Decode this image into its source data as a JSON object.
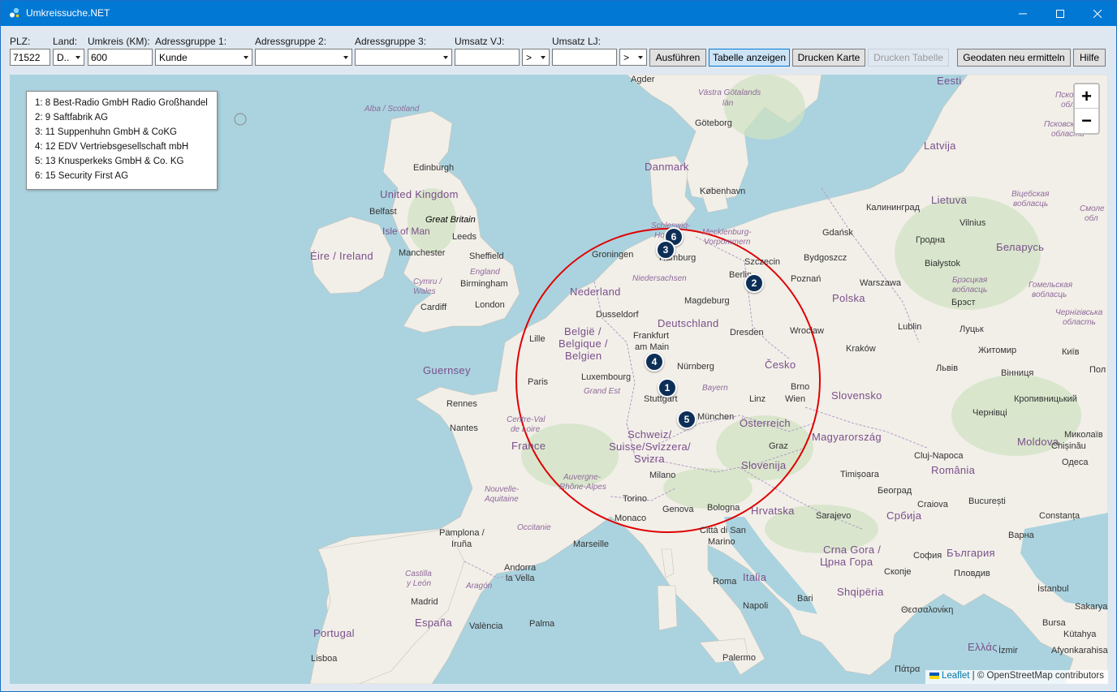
{
  "window": {
    "title": "Umkreissuche.NET",
    "accent_color": "#0078d4",
    "controls": {
      "minimize_icon": "minimize-icon",
      "maximize_icon": "maximize-icon",
      "close_icon": "close-icon"
    }
  },
  "toolbar": {
    "plz": {
      "label": "PLZ:",
      "value": "71522"
    },
    "land": {
      "label": "Land:",
      "value": "D.."
    },
    "umkreis": {
      "label": "Umkreis (KM):",
      "value": "600"
    },
    "gruppe1": {
      "label": "Adressgruppe 1:",
      "value": "Kunde"
    },
    "gruppe2": {
      "label": "Adressgruppe 2:",
      "value": ""
    },
    "gruppe3": {
      "label": "Adressgruppe 3:",
      "value": ""
    },
    "umsatz_vj": {
      "label": "Umsatz VJ:",
      "value": "",
      "operator": ">"
    },
    "umsatz_lj": {
      "label": "Umsatz LJ:",
      "value": "",
      "operator": ">"
    },
    "buttons": {
      "ausfuehren": "Ausführen",
      "tabelle_anzeigen": "Tabelle anzeigen",
      "drucken_karte": "Drucken Karte",
      "drucken_tabelle": "Drucken Tabelle",
      "geodaten": "Geodaten neu ermitteln",
      "hilfe": "Hilfe"
    }
  },
  "map": {
    "legend": [
      "1: 8 Best-Radio GmbH Radio Großhandel",
      "2: 9 Saftfabrik AG",
      "3: 11 Suppenhuhn GmbH & CoKG",
      "4: 12 EDV Vertriebsgesellschaft mbH",
      "5: 13 Knusperkeks GmbH & Co. KG",
      "6: 15 Security First AG"
    ],
    "zoom_in": "+",
    "zoom_out": "−",
    "markers": [
      "1",
      "2",
      "3",
      "4",
      "5",
      "6"
    ],
    "marker_color": "#0d2f57",
    "radius_circle_color": "#e00000",
    "attribution": {
      "leaflet": "Leaflet",
      "separator": " | © ",
      "osm": "OpenStreetMap contributors"
    },
    "countries": {
      "eesti": "Eesti",
      "latvija": "Latvija",
      "lietuva": "Lietuva",
      "danmark": "Danmark",
      "uk": "United Kingdom",
      "ireland": "Éire / Ireland",
      "nederland": "Nederland",
      "belgie1": "België /",
      "belgie2": "Belgique /",
      "belgie3": "Belgien",
      "deutschland": "Deutschland",
      "polska": "Polska",
      "belarus": "Беларусь",
      "cesko": "Česko",
      "slovensko": "Slovensko",
      "osterreich": "Österreich",
      "magyarorszag": "Magyarország",
      "schweiz1": "Schweiz/",
      "schweiz2": "Suisse/Svizzera/",
      "schweiz3": "Svizra",
      "france": "France",
      "slovenija": "Slovenija",
      "hrvatska": "Hrvatska",
      "romania": "România",
      "moldova": "Moldova",
      "srbija": "Србија",
      "espana": "España",
      "portugal": "Portugal",
      "italia": "Italia",
      "shqiperia": "Shqipëria",
      "crna_gora1": "Crna Gora /",
      "crna_gora2": "Црна Гора",
      "bulgaria": "България",
      "ellas": "Ελλάς",
      "guernsey": "Guernsey"
    },
    "cities": {
      "agder": "Agder",
      "goteborg": "Göteborg",
      "kobenhavn": "København",
      "edinburgh": "Edinburgh",
      "belfast": "Belfast",
      "great_britain": "Great Britain",
      "isle_of_man": "Isle of Man",
      "leeds": "Leeds",
      "manchester": "Manchester",
      "sheffield": "Sheffield",
      "birmingham": "Birmingham",
      "cardiff": "Cardiff",
      "london": "London",
      "groningen": "Groningen",
      "hamburg": "Hamburg",
      "szczecin": "Szczecin",
      "bydgoszcz": "Bydgoszcz",
      "gdansk": "Gdańsk",
      "kaliningrad": "Калининград",
      "vilnius": "Vilnius",
      "grodno": "Гродна",
      "bialystok": "Białystok",
      "poznan": "Poznań",
      "berlin": "Berlin",
      "warszawa": "Warszawa",
      "brest": "Брэст",
      "magdeburg": "Magdeburg",
      "dusseldorf": "Dusseldorf",
      "lille": "Lille",
      "frankfurt1": "Frankfurt",
      "frankfurt2": "am Main",
      "dresden": "Dresden",
      "wroclaw": "Wrocław",
      "lublin": "Lublin",
      "lutsk": "Луцьк",
      "krakow": "Kraków",
      "zhytomyr": "Житомир",
      "kyiv": "Київ",
      "lviv": "Львів",
      "vinnytsia": "Вінниця",
      "nurnberg": "Nürnberg",
      "paris": "Paris",
      "luxembourg": "Luxembourg",
      "stuttgart": "Stuttgart",
      "brno": "Brno",
      "linz": "Linz",
      "wien": "Wien",
      "munchen": "München",
      "kropyvnytskyi": "Кропивницький",
      "chernivtsi": "Чернівці",
      "rennes": "Rennes",
      "nantes": "Nantes",
      "graz": "Graz",
      "cluj": "Cluj-Napoca",
      "chisinau": "Chișinău",
      "mykolaiv": "Миколаїв",
      "odesa": "Одеса",
      "milano": "Milano",
      "timisoara": "Timișoara",
      "beograd": "Београд",
      "torino": "Torino",
      "genova": "Genova",
      "bologna": "Bologna",
      "monaco": "Monaco",
      "craiova": "Craiova",
      "bucuresti": "București",
      "constanta": "Constanța",
      "sarajevo": "Sarajevo",
      "pamplona1": "Pamplona /",
      "pamplona2": "Iruña",
      "marseille": "Marseille",
      "citta1": "Città di San",
      "citta2": "Marino",
      "varna": "Варна",
      "sofia": "София",
      "plovdiv": "Пловдив",
      "skopje": "Скопје",
      "andorra1": "Andorra",
      "andorra2": "la Vella",
      "roma": "Roma",
      "napoli": "Napoli",
      "bari": "Bari",
      "istanbul": "İstanbul",
      "thessaloniki": "Θεσσαλονίκη",
      "madrid": "Madrid",
      "valencia": "València",
      "palma": "Palma",
      "sakarya": "Sakarya",
      "bursa": "Bursa",
      "kutahya": "Kütahya",
      "lisboa": "Lisboa",
      "palermo": "Palermo",
      "izmir": "İzmir",
      "afyon": "Afyonkarahisar",
      "patra": "Πάτρα",
      "polt": "Пол"
    },
    "regions": {
      "alba": "Alba / Scotland",
      "england": "England",
      "cymru1": "Cymru /",
      "cymru2": "Wales",
      "vastra1": "Västra Götalands",
      "vastra2": "län",
      "schleswig": "Schleswig-",
      "holstein": "Holstein",
      "meck1": "Mecklenburg-",
      "meck2": "Vorpommern",
      "niedersachsen": "Niedersachsen",
      "bayern": "Bayern",
      "grand_est": "Grand Est",
      "centre1": "Centre-Val",
      "centre2": "de Loire",
      "auvergne1": "Auvergne-",
      "auvergne2": "Rhône-Alpes",
      "nouvelle1": "Nouvelle-",
      "nouvelle2": "Aquitaine",
      "occitanie": "Occitanie",
      "castilla1": "Castilla",
      "castilla2": "y León",
      "aragon": "Aragón",
      "pskov1": "Псковская",
      "pskov2": "область",
      "vitebsk1": "Віцебская",
      "vitebsk2": "вобласць",
      "smol1": "Смоле",
      "smol2": "обл",
      "brest1": "Брэсцкая",
      "brest2": "вобласць",
      "gomel1": "Гомельская",
      "gomel2": "вобласць",
      "chernih1": "Чернігівська",
      "chernih2": "область"
    }
  }
}
